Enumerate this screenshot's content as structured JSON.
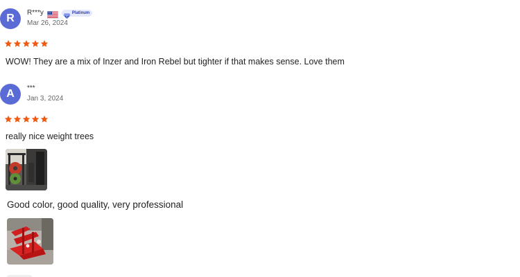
{
  "reviews": [
    {
      "avatar_letter": "R",
      "username": "R***y",
      "flag_icon": "us-flag-icon",
      "badge": {
        "icon": "diamond-icon",
        "label": "Platinum",
        "color": "#2b3aa8"
      },
      "date": "Mar 26, 2024",
      "rating": 5,
      "text": "WOW! They are a mix of Inzer and Iron Rebel but tighter if that makes sense. Love them"
    },
    {
      "avatar_letter": "A",
      "username": "***",
      "date": "Jan 3, 2024",
      "rating": 5,
      "text": "really nice weight trees",
      "photos": [
        "gym-weight-tree-photo"
      ],
      "caption": "Good color, good quality, very professional",
      "caption_photos": [
        "red-weight-tree-photo"
      ]
    }
  ],
  "colors": {
    "avatar": "#5b6bd6",
    "star": "#ee5a12",
    "text": "#222222",
    "muted": "#666666"
  }
}
